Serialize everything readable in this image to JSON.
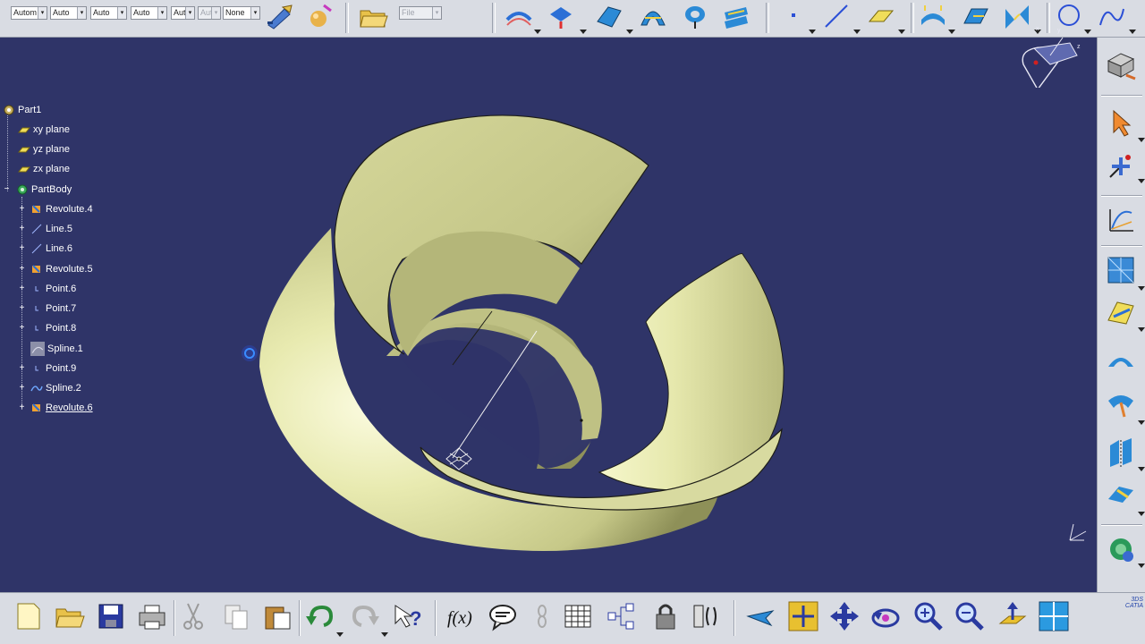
{
  "top_toolbar": {
    "combos": [
      {
        "value": "Autom",
        "enabled": true
      },
      {
        "value": "Auto",
        "enabled": true
      },
      {
        "value": "Auto",
        "enabled": true
      },
      {
        "value": "Auto",
        "enabled": true
      },
      {
        "value": "Aut",
        "enabled": true
      },
      {
        "value": "Aut",
        "enabled": false
      },
      {
        "value": "None",
        "enabled": true
      }
    ],
    "file_combo": {
      "value": "File"
    },
    "icons": [
      "paint-brush-icon",
      "material-sphere-icon",
      "open-catalog-icon",
      "boundary-icon",
      "extract-icon",
      "fill-icon",
      "sweep-icon",
      "revolve-icon",
      "loft-icon",
      "point-icon",
      "line-icon",
      "plane-icon",
      "offset-surface-icon",
      "extrude-surface-icon",
      "blend-icon",
      "circle-icon",
      "spline-icon"
    ]
  },
  "tree": {
    "root": {
      "label": "Part1",
      "icon": "part-gear-icon"
    },
    "planes": [
      {
        "label": "xy plane",
        "icon": "plane-icon"
      },
      {
        "label": "yz plane",
        "icon": "plane-icon"
      },
      {
        "label": "zx plane",
        "icon": "plane-icon"
      }
    ],
    "body": {
      "label": "PartBody",
      "icon": "partbody-gear-icon"
    },
    "features": [
      {
        "label": "Revolute.4",
        "icon": "revolute-icon",
        "expandable": true,
        "current": false
      },
      {
        "label": "Line.5",
        "icon": "line-icon",
        "expandable": true,
        "current": false
      },
      {
        "label": "Line.6",
        "icon": "line-icon",
        "expandable": true,
        "current": false
      },
      {
        "label": "Revolute.5",
        "icon": "revolute-icon",
        "expandable": true,
        "current": false
      },
      {
        "label": "Point.6",
        "icon": "point-icon",
        "expandable": true,
        "current": false
      },
      {
        "label": "Point.7",
        "icon": "point-icon",
        "expandable": true,
        "current": false
      },
      {
        "label": "Point.8",
        "icon": "point-icon",
        "expandable": true,
        "current": false
      },
      {
        "label": "Spline.1",
        "icon": "spline-sketch-icon",
        "expandable": false,
        "current": false
      },
      {
        "label": "Point.9",
        "icon": "point-icon",
        "expandable": true,
        "current": false
      },
      {
        "label": "Spline.2",
        "icon": "spline-curve-icon",
        "expandable": true,
        "current": false
      },
      {
        "label": "Revolute.6",
        "icon": "revolute-icon",
        "expandable": true,
        "current": true
      }
    ]
  },
  "right_toolbar": {
    "icons": [
      "part-design-workbench-icon",
      "select-arrow-icon",
      "snap-icon",
      "graph-law-icon",
      "tessellation-icon",
      "surface-analysis-icon",
      "dome-icon",
      "curvature-icon",
      "split-icon",
      "join-icon",
      "catalog-icon"
    ]
  },
  "bottom_toolbar": {
    "icons": [
      "new-icon",
      "open-icon",
      "save-icon",
      "print-icon",
      "cut-icon",
      "copy-icon",
      "paste-icon",
      "undo-icon",
      "redo-icon",
      "whats-this-icon",
      "formula-icon",
      "comment-icon",
      "link-icon",
      "table-icon",
      "tree-expand-icon",
      "lock-icon",
      "parameters-icon",
      "fly-mode-icon",
      "fit-all-icon",
      "pan-icon",
      "rotate-icon",
      "zoom-in-icon",
      "zoom-out-icon",
      "normal-view-icon",
      "multi-view-icon"
    ],
    "logo": "3DS CATIA"
  },
  "colors": {
    "background": "#2f3468",
    "surface": "#dfe1a6",
    "toolbar": "#d9dce3",
    "tree_text": "#ffffff"
  }
}
